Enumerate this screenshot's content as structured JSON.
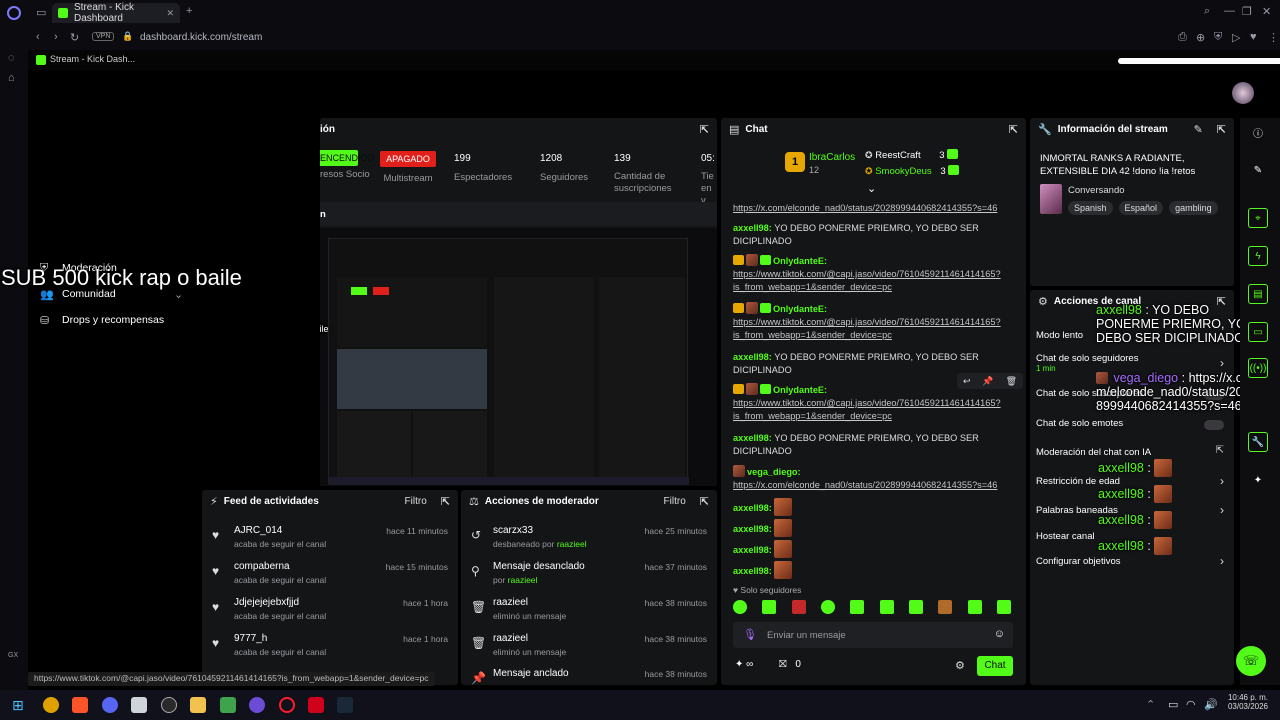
{
  "browser": {
    "tab_title": "Stream - Kick Dashboard",
    "url": "dashboard.kick.com/stream",
    "bookmark_label": "Stream - Kick Dash...",
    "vpn": "VPN",
    "status_bar_url": "https://www.tiktok.com/@capi.jaso/video/7610459211461414165?is_from_webapp=1&sender_device=pc"
  },
  "sidebar_nav": {
    "items": [
      "Moderación",
      "Comunidad",
      "Drops y recompensas"
    ]
  },
  "overlay": {
    "big_text": "SUB 500 kick  rap o  baile",
    "small_text": "SUB 500 kick  rap o  baile",
    "chat_overlay": [
      {
        "user": "axxell98",
        "text": "YO DEBO PONERME PRIEMRO, YO DEBO SER DICIPLINADO"
      },
      {
        "user": "vega_diego",
        "text": "https://x.com/elconde_nad0/status/2028999440682414355?s=46"
      },
      {
        "user": "axxell98",
        "text": ""
      },
      {
        "user": "axxell98",
        "text": ""
      },
      {
        "user": "axxell98",
        "text": ""
      },
      {
        "user": "axxell98",
        "text": ""
      }
    ]
  },
  "stream_panel": {
    "title_fragment": "ión",
    "section_fragment": "n",
    "stats": [
      {
        "value_badge": "ENCENDIDO",
        "label": "resos Socio"
      },
      {
        "value_badge": "APAGADO",
        "label": "Multistream"
      },
      {
        "value": "199",
        "label": "Espectadores"
      },
      {
        "value": "1208",
        "label": "Seguidores"
      },
      {
        "value": "139",
        "label": "Cantidad de suscripciones"
      },
      {
        "value": "05:",
        "label": "Tie en v"
      }
    ]
  },
  "activity_feed": {
    "title": "Feed de actividades",
    "filter": "Filtro",
    "items": [
      {
        "name": "AJRC_014",
        "sub": "acaba de seguir el canal",
        "time": "hace 11 minutos"
      },
      {
        "name": "compaberna",
        "sub": "acaba de seguir el canal",
        "time": "hace 15 minutos"
      },
      {
        "name": "Jdjejejejebxfjjd",
        "sub": "acaba de seguir el canal",
        "time": "hace 1 hora"
      },
      {
        "name": "9777_h",
        "sub": "acaba de seguir el canal",
        "time": "hace 1 hora"
      }
    ]
  },
  "mod_actions": {
    "title": "Acciones de moderador",
    "filter": "Filtro",
    "items": [
      {
        "name": "scarzx33",
        "sub_pre": "desbaneado por ",
        "sub_user": "raazieel",
        "time": "hace 25 minutos",
        "icon": "undo-icon"
      },
      {
        "name": "Mensaje desanclado",
        "sub_pre": "por ",
        "sub_user": "raazieel",
        "time": "hace 37 minutos",
        "icon": "unpin-icon"
      },
      {
        "name": "raazieel",
        "sub_pre": "eliminó un mensaje",
        "sub_user": "",
        "time": "hace 38 minutos",
        "icon": "trash-icon"
      },
      {
        "name": "raazieel",
        "sub_pre": "eliminó un mensaje",
        "sub_user": "",
        "time": "hace 38 minutos",
        "icon": "trash-icon"
      },
      {
        "name": "Mensaje anclado",
        "sub_pre": "",
        "sub_user": "",
        "time": "hace 38 minutos",
        "icon": "pin-icon"
      }
    ]
  },
  "chat": {
    "title": "Chat",
    "leaderboard": [
      {
        "rank": "1",
        "name": "IbraCarlos",
        "count": "12"
      },
      {
        "name": "ReestCraft",
        "count": "3"
      },
      {
        "name": "SmookyDeus",
        "count": "3"
      }
    ],
    "top_link": "https://x.com/elconde_nad0/status/2028999440682414355?s=46",
    "messages": [
      {
        "user": "axxell98:",
        "text": "YO DEBO PONERME PRIEMRO, YO DEBO SER DICIPLINADO"
      },
      {
        "user": "OnlydanteE:",
        "link": "https://www.tiktok.com/@capi.jaso/video/7610459211461414165?is_from_webapp=1&sender_device=pc"
      },
      {
        "user": "OnlydanteE:",
        "link": "https://www.tiktok.com/@capi.jaso/video/7610459211461414165?is_from_webapp=1&sender_device=pc"
      },
      {
        "user": "axxell98:",
        "text": "YO DEBO PONERME PRIEMRO, YO DEBO SER DICIPLINADO"
      },
      {
        "user": "OnlydanteE:",
        "link": "https://www.tiktok.com/@capi.jaso/video/7610459211461414165?is_from_webapp=1&sender_device=pc"
      },
      {
        "user": "axxell98:",
        "text": "YO DEBO PONERME PRIEMRO, YO DEBO SER DICIPLINADO"
      },
      {
        "user": "vega_diego:",
        "link": "https://x.com/elconde_nad0/status/2028999440682414355?s=46"
      },
      {
        "user": "axxell98:",
        "text": ""
      },
      {
        "user": "axxell98:",
        "text": ""
      },
      {
        "user": "axxell98:",
        "text": ""
      },
      {
        "user": "axxell98:",
        "text": ""
      }
    ],
    "mode_label": "Solo seguidores",
    "input_placeholder": "Enviar un mensaje",
    "points": "∞",
    "gift_count": "0",
    "send_label": "Chat"
  },
  "stream_info": {
    "title": "Información del stream",
    "stream_title": "INMORTAL RANKS A RADIANTE, EXTENSIBLE DIA 42 !dono !ia !retos",
    "category": "Conversando",
    "tags": [
      "Spanish",
      "Español",
      "gambling"
    ]
  },
  "channel_actions": {
    "title": "Acciones de canal",
    "items": [
      {
        "label": "Modo lento"
      },
      {
        "label": "Chat de solo seguidores",
        "sub": "1 min"
      },
      {
        "label": "Chat de solo suscriptores"
      },
      {
        "label": "Chat de solo emotes"
      },
      {
        "label": "Moderación del chat con IA"
      },
      {
        "label": "Restricción de edad"
      },
      {
        "label": "Palabras baneadas"
      },
      {
        "label": "Hostear canal"
      },
      {
        "label": "Configurar objetivos"
      }
    ]
  },
  "taskbar": {
    "time": "10:46 p. m.",
    "date": "03/03/2026"
  },
  "colors": {
    "kick_green": "#53fc18",
    "red": "#e1201c",
    "panel": "#141517"
  }
}
